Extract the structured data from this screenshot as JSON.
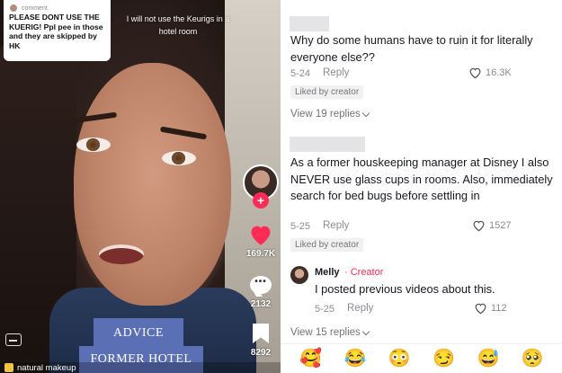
{
  "video": {
    "caption": {
      "label": "comment",
      "text": "PLEASE DONT USE THE KUERIG! Ppl pee in those and they are skipped by HK"
    },
    "overlay_text": "I will not use the Keurigs in a hotel room",
    "banner_line1": "ADVICE FROM A",
    "banner_line2": "FORMER HOTEL MANAGER",
    "likes": "169.7K",
    "comments": "2132",
    "saves": "8292",
    "bottom_label": "natural makeup",
    "follow_symbol": "+",
    "bubble_dots": "•••"
  },
  "comments": [
    {
      "text": "Why do some humans have to ruin it for literally everyone else??",
      "date": "5-24",
      "reply_label": "Reply",
      "likes": "16.3K",
      "badge": "Liked by creator",
      "view_replies": "View 19 replies"
    },
    {
      "text": "As a former houskeeping manager at Disney I also NEVER use glass cups in rooms. Also, immediately search for bed bugs before settling in",
      "date": "5-25",
      "reply_label": "Reply",
      "likes": "1527",
      "badge": "Liked by creator",
      "reply": {
        "name": "Melly",
        "creator_tag": "· Creator",
        "text": "I posted previous videos about this.",
        "date": "5-25",
        "reply_label": "Reply",
        "likes": "112"
      },
      "view_replies": "View 15 replies"
    }
  ],
  "emoji_bar": [
    "🥰",
    "😂",
    "😳",
    "😏",
    "😅",
    "🥺"
  ],
  "colors": {
    "accent": "#fe2c55",
    "banner": "#5b6fb4",
    "muted_text": "#8a8b91",
    "badge_bg": "#f1f1f2"
  },
  "icons": [
    "heart-icon",
    "comment-icon",
    "bookmark-icon",
    "captions-icon",
    "shopping-bag-icon",
    "chevron-down-icon"
  ]
}
